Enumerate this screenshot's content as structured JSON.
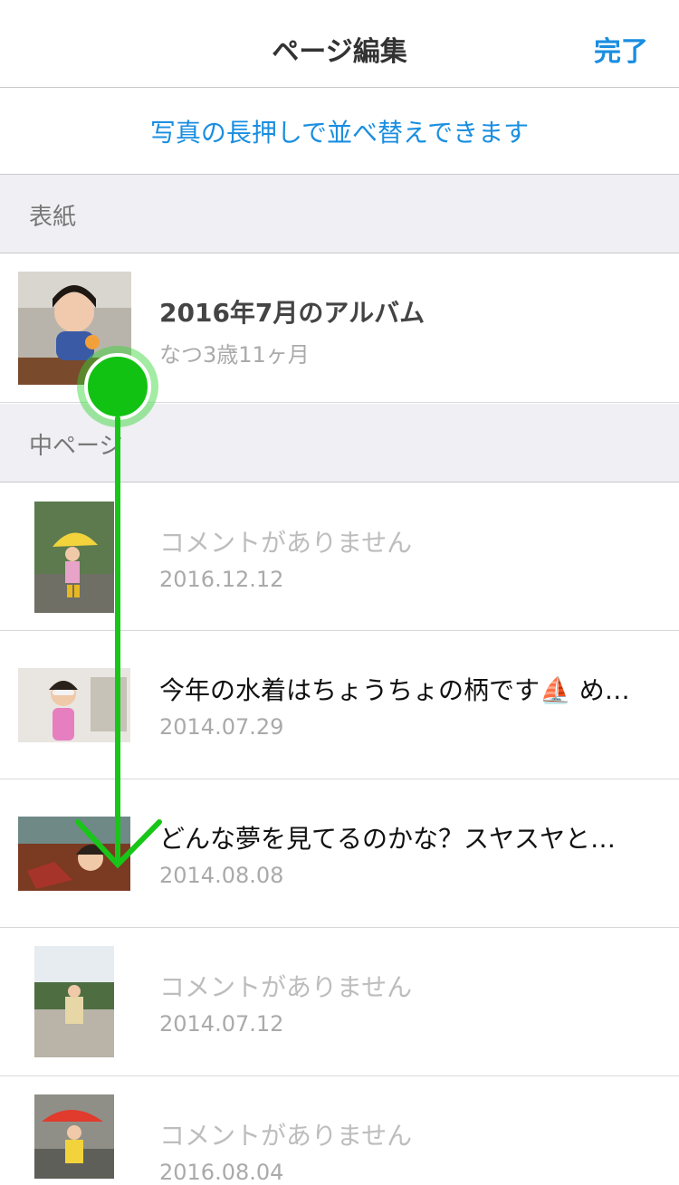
{
  "nav": {
    "title": "ページ編集",
    "done_label": "完了"
  },
  "hint": "写真の長押しで並べ替えできます",
  "sections": {
    "cover": "表紙",
    "inner": "中ページ"
  },
  "cover": {
    "title": "2016年7月のアルバム",
    "subtitle": "なつ3歳11ヶ月"
  },
  "pages": [
    {
      "title": "コメントがありません",
      "date": "2016.12.12"
    },
    {
      "title": "今年の水着はちょうちょの柄です⛵ め…",
      "date": "2014.07.29"
    },
    {
      "title": "どんな夢を見てるのかな？スヤスヤと…",
      "date": "2014.08.08"
    },
    {
      "title": "コメントがありません",
      "date": "2014.07.12"
    },
    {
      "title": "コメントがありません",
      "date": "2016.08.04"
    }
  ],
  "colors": {
    "accent": "#1a8ee0",
    "gesture": "#1ec81e"
  }
}
